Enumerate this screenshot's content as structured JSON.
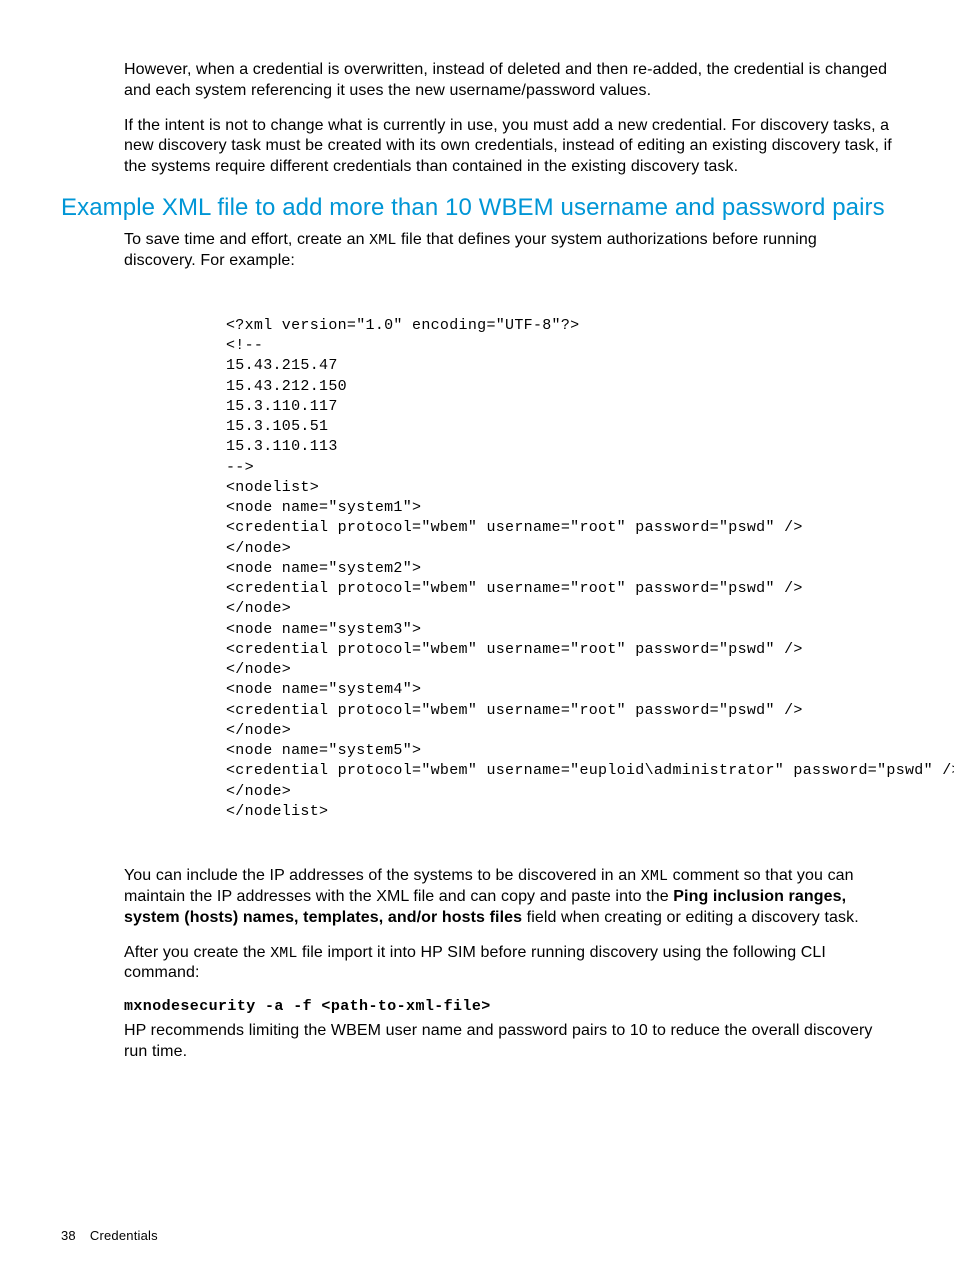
{
  "para1": "However, when a credential is overwritten, instead of deleted and then re-added, the credential is changed and each system referencing it uses the new username/password values.",
  "para2": "If the intent is not to change what is currently in use, you must add a new credential. For discovery tasks, a new discovery task must be created with its own credentials, instead of editing an existing discovery task, if the systems require different credentials than contained in the existing discovery task.",
  "section_title": "Example XML file to add more than 10 WBEM username and password pairs",
  "para3_a": "To save time and effort, create an ",
  "para3_code": "XML",
  "para3_b": " file that defines your system authorizations before running discovery. For example:",
  "code_block": "<?xml version=\"1.0\" encoding=\"UTF-8\"?>\n<!--\n15.43.215.47\n15.43.212.150\n15.3.110.117\n15.3.105.51\n15.3.110.113\n-->\n<nodelist>\n<node name=\"system1\">\n<credential protocol=\"wbem\" username=\"root\" password=\"pswd\" />\n</node>\n<node name=\"system2\">\n<credential protocol=\"wbem\" username=\"root\" password=\"pswd\" />\n</node>\n<node name=\"system3\">\n<credential protocol=\"wbem\" username=\"root\" password=\"pswd\" />\n</node>\n<node name=\"system4\">\n<credential protocol=\"wbem\" username=\"root\" password=\"pswd\" />\n</node>\n<node name=\"system5\">\n<credential protocol=\"wbem\" username=\"euploid\\administrator\" password=\"pswd\" />\n</node>\n</nodelist>",
  "para4_a": "You can include the IP addresses of the systems to be discovered in an ",
  "para4_code": "XML",
  "para4_b": " comment so that you can maintain the IP addresses with the XML file and can copy and paste into the ",
  "para4_bold": "Ping inclusion ranges, system (hosts) names, templates, and/or hosts files",
  "para4_c": " field when creating or editing a discovery task.",
  "para5_a": "After you create the ",
  "para5_code": "XML",
  "para5_b": " file import it into HP SIM before running discovery using the following CLI command:",
  "cli_command": "mxnodesecurity -a -f <path-to-xml-file>",
  "para6": "HP recommends limiting the WBEM user name and password pairs to 10 to reduce the overall discovery run time.",
  "footer_page": "38",
  "footer_label": "Credentials"
}
